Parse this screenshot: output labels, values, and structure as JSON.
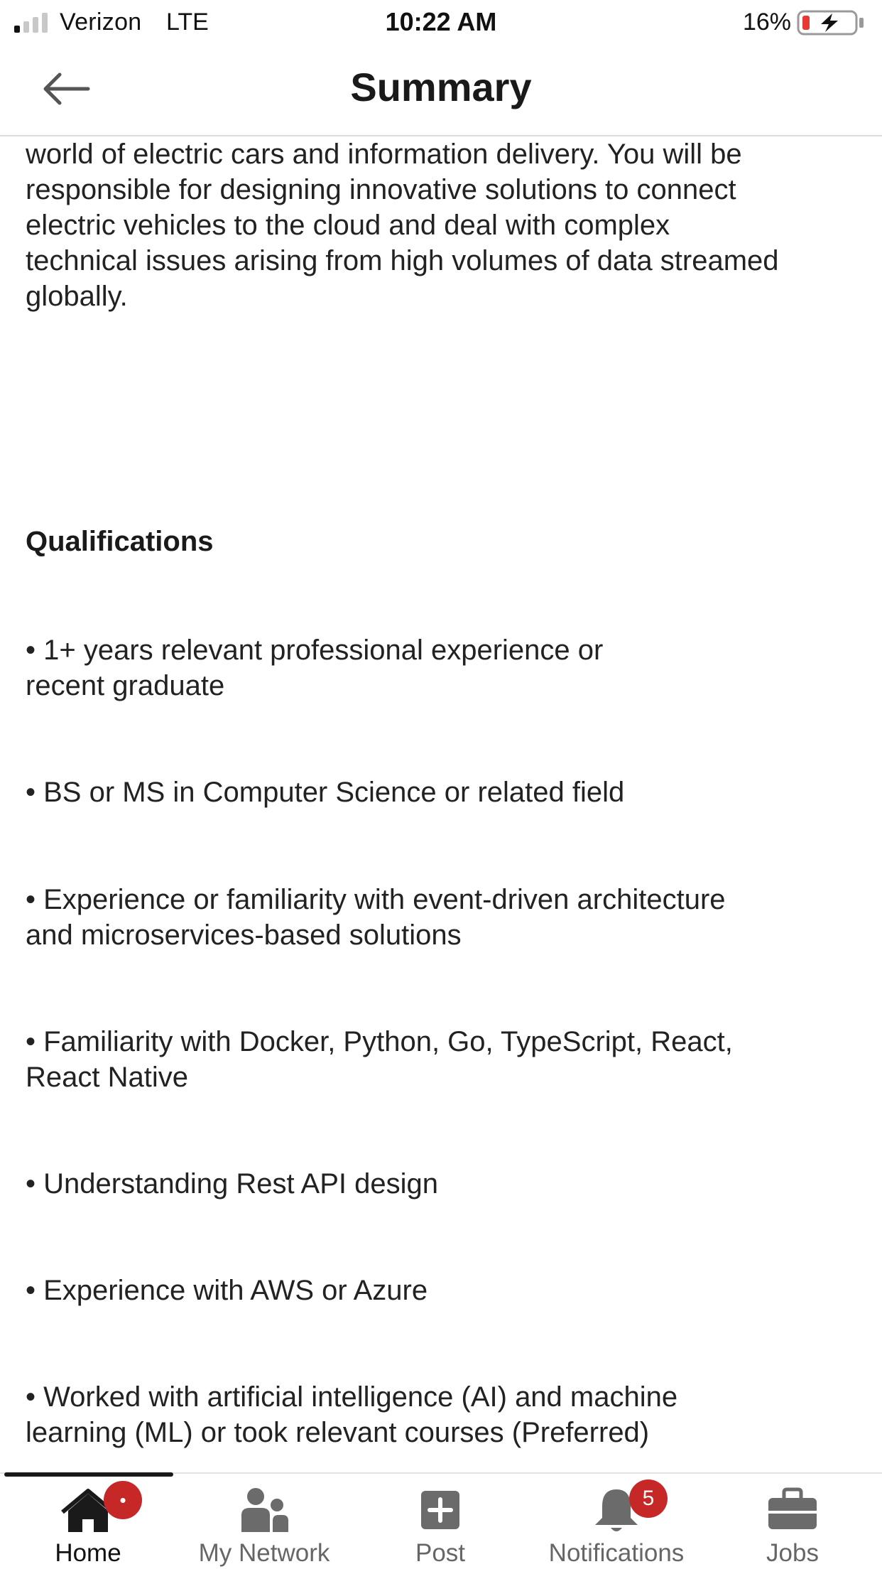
{
  "status_bar": {
    "carrier": "Verizon",
    "network": "LTE",
    "time": "10:22 AM",
    "battery_percent": "16%"
  },
  "header": {
    "title": "Summary",
    "back_icon": "arrow-left-icon"
  },
  "content": {
    "intro_lines": [
      "world of electric cars and information delivery. You will be",
      "responsible for designing innovative solutions to connect",
      "electric vehicles to the cloud and deal with complex",
      "technical issues arising from high volumes of data streamed",
      "globally."
    ],
    "qualifications_heading": "Qualifications",
    "qualifications": [
      [
        "• 1+ years relevant professional experience or",
        "recent graduate"
      ],
      [
        "• BS or MS in Computer Science or related field"
      ],
      [
        "• Experience or familiarity with event-driven architecture",
        "and microservices-based solutions"
      ],
      [
        "• Familiarity with Docker, Python, Go, TypeScript, React,",
        "React Native"
      ],
      [
        "• Understanding Rest API design"
      ],
      [
        "• Experience with AWS or Azure"
      ],
      [
        "• Worked with artificial intelligence (AI) and machine",
        "learning (ML) or took relevant courses (Preferred)"
      ]
    ]
  },
  "bottom_nav": {
    "items": [
      {
        "label": "Home",
        "icon": "home-icon",
        "active": true,
        "badge": "•"
      },
      {
        "label": "My Network",
        "icon": "network-icon",
        "active": false
      },
      {
        "label": "Post",
        "icon": "post-plus-icon",
        "active": false
      },
      {
        "label": "Notifications",
        "icon": "bell-icon",
        "active": false,
        "badge": "5"
      },
      {
        "label": "Jobs",
        "icon": "briefcase-icon",
        "active": false
      }
    ]
  },
  "colors": {
    "badge": "#c62828",
    "nav_icon_inactive": "#6b6b6b",
    "nav_icon_active": "#1a1a1a",
    "battery_low": "#e53935"
  }
}
